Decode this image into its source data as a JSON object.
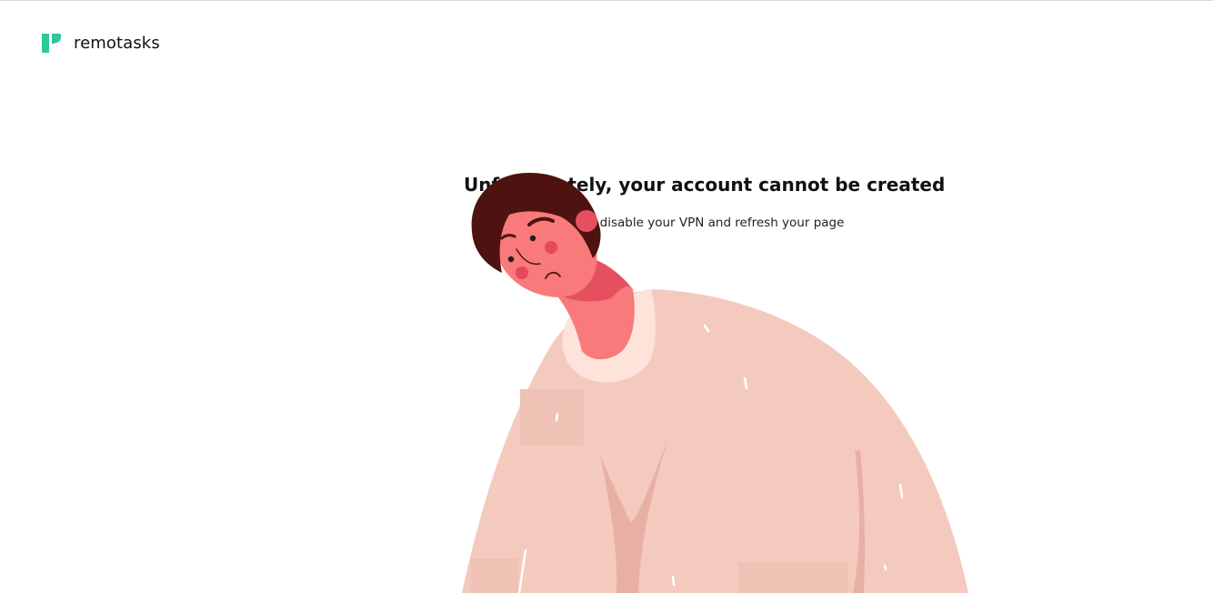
{
  "brand": {
    "name": "remotasks",
    "accent_color": "#2ec99a"
  },
  "error": {
    "title": "Unfortunately, your account cannot be created",
    "message": "Please disable your VPN and refresh your page"
  },
  "illustration": {
    "subject": "sad-person-illustration",
    "colors": {
      "hair": "#4e1210",
      "skin": "#f87a7a",
      "shadow": "#e5505f",
      "cheek": "#e8485c",
      "sweater": "#f4cabf",
      "collar": "#fde3da",
      "fold": "#e8b0a4"
    }
  }
}
